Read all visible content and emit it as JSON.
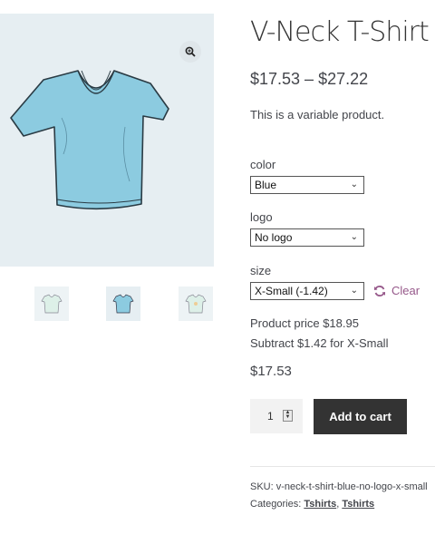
{
  "product": {
    "title": "V-Neck T-Shirt",
    "price_range": "$17.53 – $27.22",
    "short_description": "This is a variable product."
  },
  "variations": {
    "color": {
      "label": "color",
      "value": "Blue"
    },
    "logo": {
      "label": "logo",
      "value": "No logo"
    },
    "size": {
      "label": "size",
      "value": "X-Small (-1.42)"
    },
    "clear_label": "Clear"
  },
  "pricing": {
    "product_price_line": "Product price $18.95",
    "subtract_line": "Subtract $1.42 for X-Small",
    "final_price": "$17.53"
  },
  "cart": {
    "quantity": "1",
    "add_to_cart_label": "Add to cart"
  },
  "meta": {
    "sku_label": "SKU:",
    "sku_value": "v-neck-t-shirt-blue-no-logo-x-small",
    "categories_label": "Categories:",
    "categories": [
      "Tshirts",
      "Tshirts"
    ]
  },
  "icons": {
    "zoom": "zoom-in-icon",
    "clear": "refresh-icon",
    "dropdown": "chevron-down-icon"
  },
  "colors": {
    "accent": "#96588a",
    "button_bg": "#333333",
    "gallery_bg": "#e6eef2",
    "shirt_blue": "#8ccbe0"
  }
}
